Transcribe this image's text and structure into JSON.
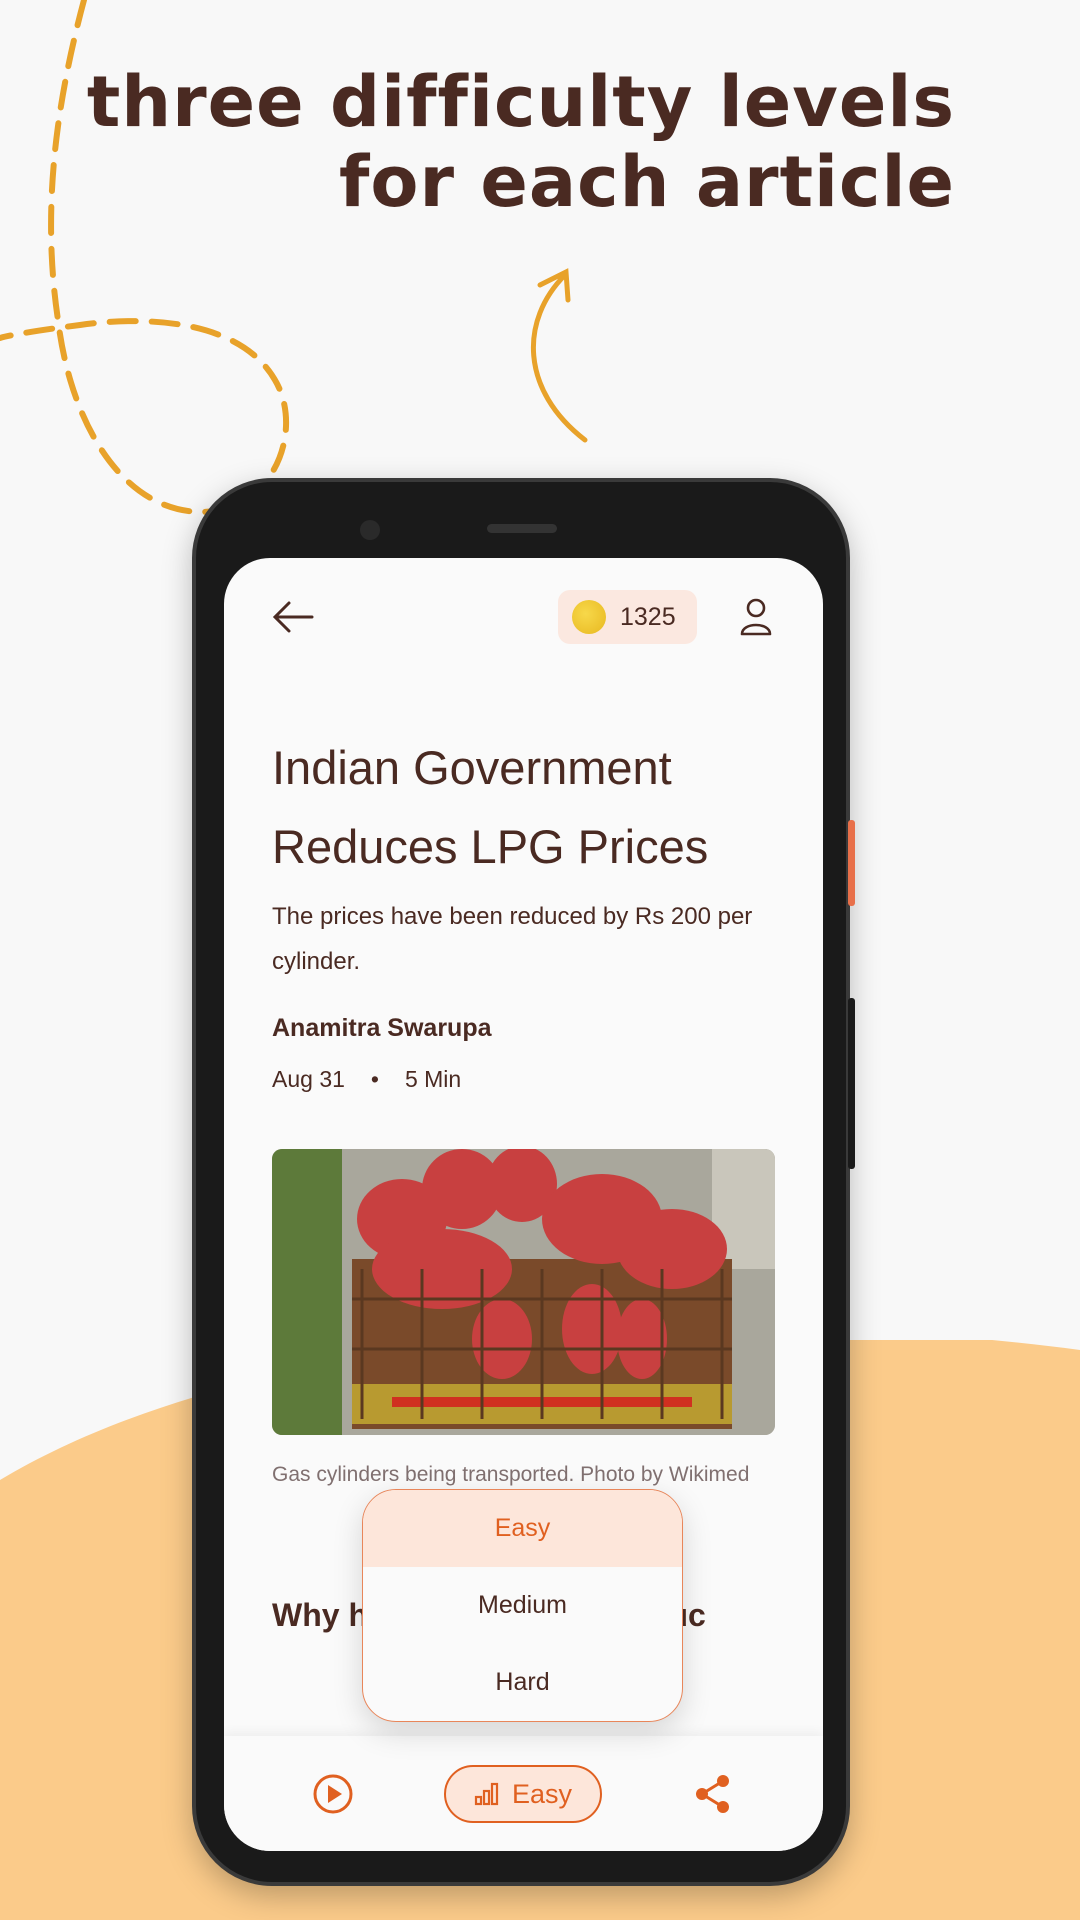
{
  "promo": {
    "headline_line1": "three difficulty levels",
    "headline_line2": "for each article"
  },
  "header": {
    "back_icon": "arrow-left-icon",
    "coins": "1325",
    "profile_icon": "user-icon"
  },
  "article": {
    "title": "Indian Government Reduces LPG Prices",
    "subtitle": "The prices have been reduced by Rs 200 per cylinder.",
    "author": "Anamitra Swarupa",
    "date": "Aug 31",
    "separator": "•",
    "read_time": "5 Min",
    "image_caption": "Gas cylinders being transported. Photo by Wikimed",
    "section_heading": "Why h                          t reduc"
  },
  "difficulty_menu": {
    "options": [
      "Easy",
      "Medium",
      "Hard"
    ],
    "selected": "Easy"
  },
  "bottom_bar": {
    "level_label": "Easy",
    "play_icon": "play-circle-icon",
    "share_icon": "share-icon"
  },
  "colors": {
    "accent": "#e06020",
    "text": "#4a2a22",
    "background_blob": "#fbcb8a",
    "deco_dashes": "#e8a22a"
  }
}
